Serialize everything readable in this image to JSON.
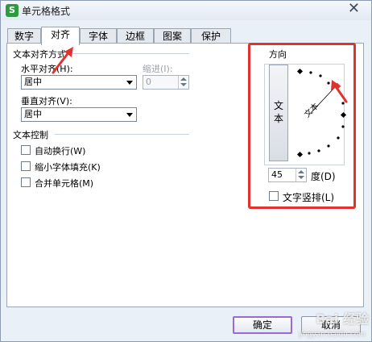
{
  "window": {
    "title": "单元格格式",
    "app_icon": "S",
    "close_glyph": "✕"
  },
  "tabs": [
    {
      "label": "数字",
      "active": false
    },
    {
      "label": "对齐",
      "active": true
    },
    {
      "label": "字体",
      "active": false
    },
    {
      "label": "边框",
      "active": false
    },
    {
      "label": "图案",
      "active": false
    },
    {
      "label": "保护",
      "active": false
    }
  ],
  "alignment": {
    "group_label": "文本对齐方式",
    "horizontal_label": "水平对齐(H):",
    "horizontal_value": "居中",
    "indent_label": "缩进(I):",
    "indent_value": "0",
    "vertical_label": "垂直对齐(V):",
    "vertical_value": "居中"
  },
  "text_control": {
    "group_label": "文本控制",
    "wrap_text": "自动换行(W)",
    "shrink_to_fit": "缩小字体填充(K)",
    "merge_cells": "合并单元格(M)"
  },
  "orientation": {
    "group_label": "方向",
    "vertical_text_chars": [
      "文",
      "本"
    ],
    "dial_text": "文本",
    "degrees_value": "45",
    "degrees_label": "度(D)",
    "vertical_checkbox_label": "文字竖排(L)"
  },
  "buttons": {
    "ok": "确定",
    "cancel": "取消"
  },
  "colors": {
    "highlight_red": "#e0332f",
    "ok_border": "#9b6ad0",
    "app_icon_green": "#2f9b3e"
  }
}
